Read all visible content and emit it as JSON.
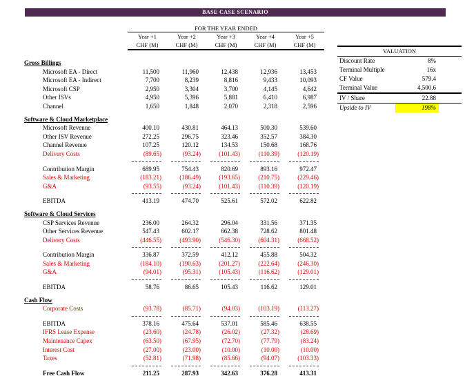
{
  "banner": {
    "title": "BASE CASE SCENARIO"
  },
  "table": {
    "period_header": "FOR THE YEAR ENDED",
    "columns": [
      "Year +1",
      "Year +2",
      "Year +3",
      "Year +4",
      "Year +5"
    ],
    "unit_label": "CHF (M)",
    "sections": [
      {
        "title": "Gross Billings",
        "rows": [
          {
            "label": "Microsoft EA - Direct",
            "style": "normal",
            "values": [
              "11,500",
              "11,960",
              "12,438",
              "12,936",
              "13,453"
            ]
          },
          {
            "label": "Microsoft EA - Indirect",
            "style": "normal",
            "values": [
              "7,700",
              "8,239",
              "8,816",
              "9,433",
              "10,093"
            ]
          },
          {
            "label": "Microsoft CSP",
            "style": "normal",
            "values": [
              "2,950",
              "3,304",
              "3,700",
              "4,145",
              "4,642"
            ]
          },
          {
            "label": "Other ISVs",
            "style": "normal",
            "values": [
              "4,950",
              "5,396",
              "5,881",
              "6,410",
              "6,987"
            ]
          },
          {
            "label": "Channel",
            "style": "normal",
            "values": [
              "1,650",
              "1,848",
              "2,070",
              "2,318",
              "2,596"
            ]
          }
        ]
      },
      {
        "title": "Software & Cloud Marketplace",
        "rows": [
          {
            "label": "Microsoft Revenue",
            "style": "normal",
            "values": [
              "400.10",
              "430.81",
              "464.13",
              "500.30",
              "539.60"
            ]
          },
          {
            "label": "Other ISV Revenue",
            "style": "normal",
            "values": [
              "272.25",
              "296.75",
              "323.46",
              "352.57",
              "384.30"
            ]
          },
          {
            "label": "Channel Revenue",
            "style": "normal",
            "values": [
              "107.25",
              "120.12",
              "134.53",
              "150.68",
              "168.76"
            ]
          },
          {
            "label": "Delivery Costs",
            "style": "red",
            "values": [
              "(89.65)",
              "(93.24)",
              "(101.43)",
              "(110.39)",
              "(120.19)"
            ]
          },
          {
            "style": "dashes"
          },
          {
            "label": "Contribution Margin",
            "style": "normal",
            "values": [
              "689.95",
              "754.43",
              "820.69",
              "893.16",
              "972.47"
            ]
          },
          {
            "label": "Sales & Marketing",
            "style": "red",
            "values": [
              "(183.21)",
              "(186.49)",
              "(193.65)",
              "(210.75)",
              "(229.46)"
            ]
          },
          {
            "label": "G&A",
            "style": "red",
            "values": [
              "(93.55)",
              "(93.24)",
              "(101.43)",
              "(110.39)",
              "(120.19)"
            ]
          },
          {
            "style": "dashes"
          },
          {
            "label": "EBITDA",
            "style": "normal",
            "values": [
              "413.19",
              "474.70",
              "525.61",
              "572.02",
              "622.82"
            ]
          }
        ]
      },
      {
        "title": "Software & Cloud Services",
        "rows": [
          {
            "label": "CSP Services Revenue",
            "style": "normal",
            "values": [
              "236.00",
              "264.32",
              "296.04",
              "331.56",
              "371.35"
            ]
          },
          {
            "label": "Other Services Revenue",
            "style": "normal",
            "values": [
              "547.43",
              "602.17",
              "662.38",
              "728.62",
              "801.48"
            ]
          },
          {
            "label": "Delivery Costs",
            "style": "red",
            "values": [
              "(446.55)",
              "(493.90)",
              "(546.30)",
              "(604.31)",
              "(668.52)"
            ]
          },
          {
            "style": "dashes"
          },
          {
            "label": "Contribution Margin",
            "style": "normal",
            "values": [
              "336.87",
              "372.59",
              "412.12",
              "455.88",
              "504.32"
            ]
          },
          {
            "label": "Sales & Marketing",
            "style": "red",
            "values": [
              "(184.10)",
              "(190.63)",
              "(201.27)",
              "(222.64)",
              "(246.30)"
            ]
          },
          {
            "label": "G&A",
            "style": "red",
            "values": [
              "(94.01)",
              "(95.31)",
              "(105.43)",
              "(116.62)",
              "(129.01)"
            ]
          },
          {
            "style": "dashes"
          },
          {
            "label": "EBITDA",
            "style": "normal",
            "values": [
              "58.76",
              "86.65",
              "105.43",
              "116.62",
              "129.01"
            ]
          }
        ]
      },
      {
        "title": "Cash Flow",
        "rows": [
          {
            "label": "Corporate Costs",
            "style": "red",
            "values": [
              "(93.78)",
              "(85.71)",
              "(94.03)",
              "(103.19)",
              "(113.27)"
            ]
          },
          {
            "style": "dashes"
          },
          {
            "label": "EBITDA",
            "style": "normal",
            "values": [
              "378.16",
              "475.64",
              "537.01",
              "585.46",
              "638.55"
            ]
          },
          {
            "label": "IFRS Lease Expense",
            "style": "red",
            "values": [
              "(23.60)",
              "(24.78)",
              "(26.02)",
              "(27.32)",
              "(28.69)"
            ]
          },
          {
            "label": "Maintenance Capex",
            "style": "red",
            "values": [
              "(63.50)",
              "(67.95)",
              "(72.70)",
              "(77.79)",
              "(83.24)"
            ]
          },
          {
            "label": "Interest Cost",
            "style": "red",
            "values": [
              "(27.00)",
              "(23.00)",
              "(10.00)",
              "(10.00)",
              "(10.00)"
            ]
          },
          {
            "label": "Taxes",
            "style": "red",
            "values": [
              "(52.81)",
              "(71.98)",
              "(85.66)",
              "(94.07)",
              "(103.33)"
            ]
          },
          {
            "style": "dashes"
          },
          {
            "label": "Free Cash Flow",
            "style": "bold",
            "values": [
              "211.25",
              "287.93",
              "342.63",
              "376.28",
              "413.31"
            ]
          }
        ]
      }
    ]
  },
  "valuation": {
    "title": "VALUATION",
    "rows": [
      {
        "label": "Discount Rate",
        "value": "8%",
        "style": "normal"
      },
      {
        "label": "Terminal Multiple",
        "value": "16x",
        "style": "normal"
      },
      {
        "label": "CF Value",
        "value": "579.4",
        "style": "normal"
      },
      {
        "label": "Terminal Value",
        "value": "4,500.6",
        "style": "rule-below"
      },
      {
        "label": "IV / Share",
        "value": "22.88",
        "style": "underline-below"
      },
      {
        "label": "Upside to IV",
        "value": "198%",
        "style": "highlight"
      }
    ]
  },
  "colors": {
    "banner_bg": "#4e2a50",
    "negative_red": "#e00000",
    "highlight_yellow": "#ffff00"
  }
}
